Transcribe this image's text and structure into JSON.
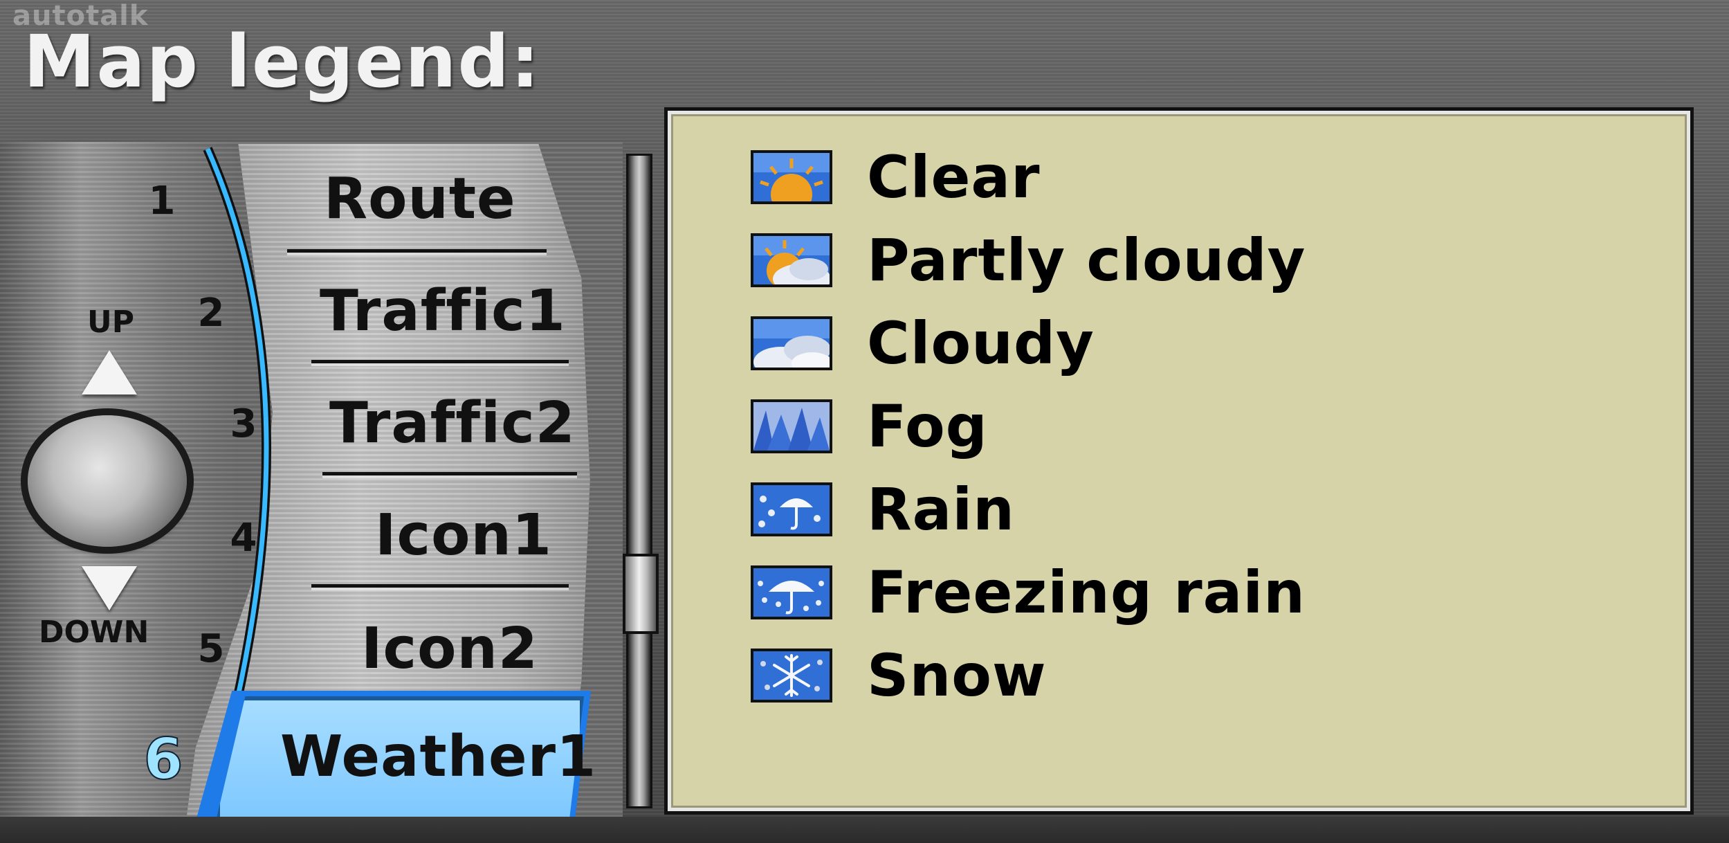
{
  "watermark": "autotalk",
  "page_title": "Map legend:",
  "controls": {
    "up_label": "UP",
    "down_label": "DOWN"
  },
  "menu": {
    "items": [
      {
        "number": "1",
        "label": "Route"
      },
      {
        "number": "2",
        "label": "Traffic1"
      },
      {
        "number": "3",
        "label": "Traffic2"
      },
      {
        "number": "4",
        "label": "Icon1"
      },
      {
        "number": "5",
        "label": "Icon2"
      },
      {
        "number": "6",
        "label": "Weather1",
        "selected": true
      }
    ]
  },
  "legend": {
    "items": [
      {
        "icon": "clear-weather-icon",
        "label": "Clear"
      },
      {
        "icon": "partly-cloudy-icon",
        "label": "Partly cloudy"
      },
      {
        "icon": "cloudy-icon",
        "label": "Cloudy"
      },
      {
        "icon": "fog-icon",
        "label": "Fog"
      },
      {
        "icon": "rain-icon",
        "label": "Rain"
      },
      {
        "icon": "freezing-rain-icon",
        "label": "Freezing rain"
      },
      {
        "icon": "snow-icon",
        "label": "Snow"
      }
    ]
  },
  "colors": {
    "legend_background": "#d6d3a8",
    "selected_item": "#8fd0ff",
    "selected_border": "#1e7be8",
    "icon_blue": "#2f6fd6",
    "icon_sun": "#f0a020"
  }
}
